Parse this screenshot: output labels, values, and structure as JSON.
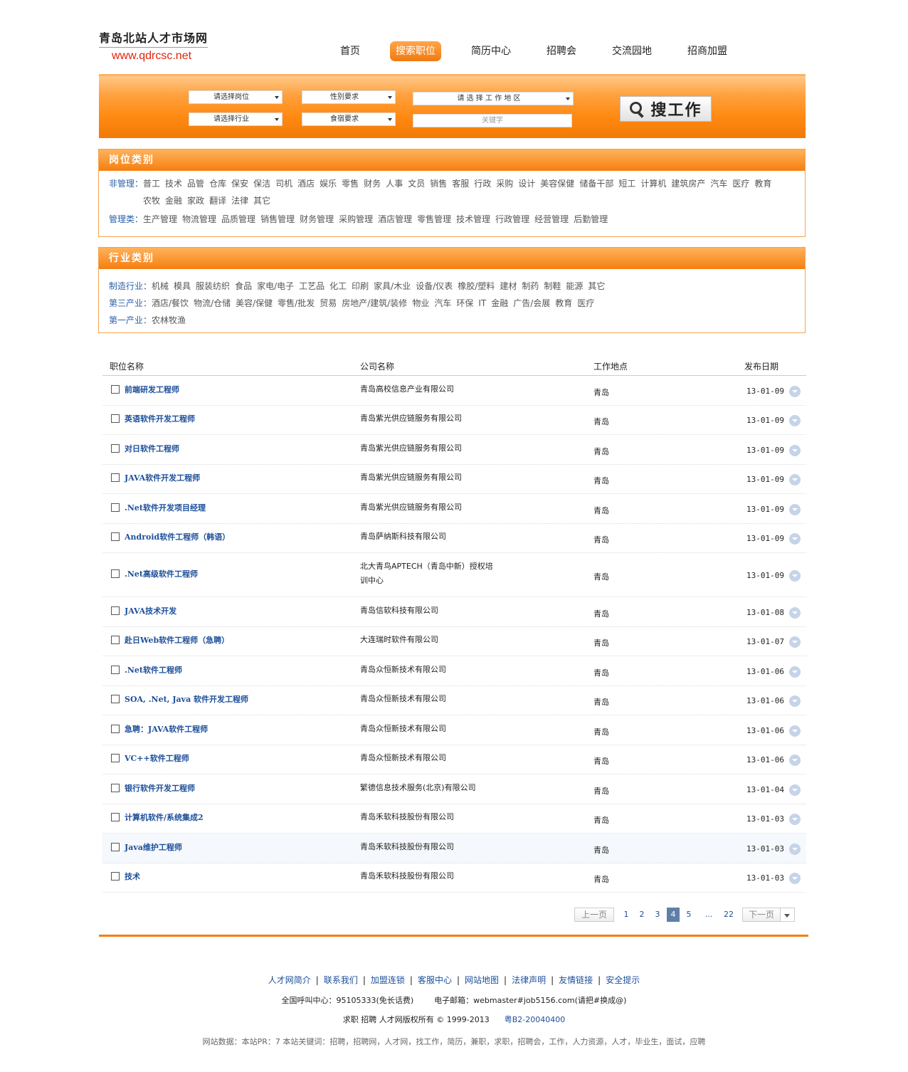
{
  "logo": {
    "name": "青岛北站人才市场网",
    "url": "www.qdrcsc.net"
  },
  "nav": [
    "首页",
    "搜索职位",
    "简历中心",
    "招聘会",
    "交流园地",
    "招商加盟"
  ],
  "search": {
    "position_select": "请选择岗位",
    "gender_select": "性别要求",
    "area_select": "请 选 择 工 作 地 区",
    "industry_select": "请选择行业",
    "lodging_select": "食宿要求",
    "keyword_placeholder": "关键字",
    "button_label": "搜工作"
  },
  "job_categories": {
    "title": "岗位类别",
    "rows": [
      {
        "label": "非管理：",
        "items": [
          "普工",
          "技术",
          "品管",
          "仓库",
          "保安",
          "保洁",
          "司机",
          "酒店",
          "娱乐",
          "零售",
          "财务",
          "人事",
          "文员",
          "销售",
          "客服",
          "行政",
          "采购",
          "设计",
          "美容保健",
          "储备干部",
          "短工",
          "计算机",
          "建筑房产",
          "汽车",
          "医疗",
          "教育",
          "农牧",
          "金融",
          "家政",
          "翻译",
          "法律",
          "其它"
        ]
      },
      {
        "label": "管理类：",
        "items": [
          "生产管理",
          "物流管理",
          "品质管理",
          "销售管理",
          "财务管理",
          "采购管理",
          "酒店管理",
          "零售管理",
          "技术管理",
          "行政管理",
          "经营管理",
          "后勤管理"
        ]
      }
    ]
  },
  "industry_categories": {
    "title": "行业类别",
    "rows": [
      {
        "label": "制造行业：",
        "items": [
          "机械",
          "模具",
          "服装纺织",
          "食品",
          "家电/电子",
          "工艺品",
          "化工",
          "印刷",
          "家具/木业",
          "设备/仪表",
          "橡胶/塑料",
          "建材",
          "制药",
          "制鞋",
          "能源",
          "其它"
        ]
      },
      {
        "label": "第三产业：",
        "items": [
          "酒店/餐饮",
          "物流/仓储",
          "美容/保健",
          "零售/批发",
          "贸易",
          "房地产/建筑/装修",
          "物业",
          "汽车",
          "环保",
          "IT",
          "金融",
          "广告/会展",
          "教育",
          "医疗"
        ]
      },
      {
        "label": "第一产业：",
        "items": [
          "农林牧渔"
        ]
      }
    ]
  },
  "table": {
    "headers": [
      "职位名称",
      "公司名称",
      "工作地点",
      "发布日期"
    ],
    "rows": [
      {
        "title": "前端研发工程师",
        "company": "青岛高校信息产业有限公司",
        "location": "青岛",
        "date": "13-01-09"
      },
      {
        "title": "英语软件开发工程师",
        "company": "青岛紫光供应链服务有限公司",
        "location": "青岛",
        "date": "13-01-09"
      },
      {
        "title": "对日软件工程师",
        "company": "青岛紫光供应链服务有限公司",
        "location": "青岛",
        "date": "13-01-09"
      },
      {
        "title": "JAVA软件开发工程师",
        "company": "青岛紫光供应链服务有限公司",
        "location": "青岛",
        "date": "13-01-09"
      },
      {
        "title": ".Net软件开发项目经理",
        "company": "青岛紫光供应链服务有限公司",
        "location": "青岛",
        "date": "13-01-09"
      },
      {
        "title": "Android软件工程师（韩语）",
        "company": "青岛萨纳斯科技有限公司",
        "location": "青岛",
        "date": "13-01-09"
      },
      {
        "title": ".Net高级软件工程师",
        "company": "北大青鸟APTECH（青岛中新）授权培训中心",
        "location": "青岛",
        "date": "13-01-09"
      },
      {
        "title": "JAVA技术开发",
        "company": "青岛信软科技有限公司",
        "location": "青岛",
        "date": "13-01-08"
      },
      {
        "title": "赴日Web软件工程师（急聘）",
        "company": "大连瑞时软件有限公司",
        "location": "青岛",
        "date": "13-01-07"
      },
      {
        "title": ".Net软件工程师",
        "company": "青岛众恒新技术有限公司",
        "location": "青岛",
        "date": "13-01-06"
      },
      {
        "title": "SOA, .Net, Java 软件开发工程师",
        "company": "青岛众恒新技术有限公司",
        "location": "青岛",
        "date": "13-01-06"
      },
      {
        "title": "急聘：JAVA软件工程师",
        "company": "青岛众恒新技术有限公司",
        "location": "青岛",
        "date": "13-01-06"
      },
      {
        "title": "VC++软件工程师",
        "company": "青岛众恒新技术有限公司",
        "location": "青岛",
        "date": "13-01-06"
      },
      {
        "title": "银行软件开发工程师",
        "company": "繁德信息技术服务(北京)有限公司",
        "location": "青岛",
        "date": "13-01-04"
      },
      {
        "title": "计算机软件/系统集成2",
        "company": "青岛禾软科技股份有限公司",
        "location": "青岛",
        "date": "13-01-03"
      },
      {
        "title": "Java维护工程师",
        "company": "青岛禾软科技股份有限公司",
        "location": "青岛",
        "date": "13-01-03"
      },
      {
        "title": "技术",
        "company": "青岛禾软科技股份有限公司",
        "location": "青岛",
        "date": "13-01-03"
      }
    ]
  },
  "pagination": {
    "prev": "上一页",
    "pages": [
      "1",
      "2",
      "3",
      "4",
      "5",
      "...",
      "22"
    ],
    "current": "4",
    "next": "下一页"
  },
  "footer": {
    "links": [
      "人才网简介",
      "联系我们",
      "加盟连锁",
      "客服中心",
      "网站地图",
      "法律声明",
      "友情链接",
      "安全提示"
    ],
    "hotline": "全国呼叫中心：95105333(免长话费)",
    "email": "电子邮箱：webmaster#job5156.com(请把#换成@)",
    "copyright": "求职 招聘 人才网版权所有 © 1999-2013",
    "icp": "粤B2-20040400",
    "keywords": "网站数据：本站PR：7 本站关键词：招聘，招聘网，人才网，找工作，简历，兼职，求职，招聘会，工作，人力资源，人才，毕业生，面试，应聘"
  }
}
